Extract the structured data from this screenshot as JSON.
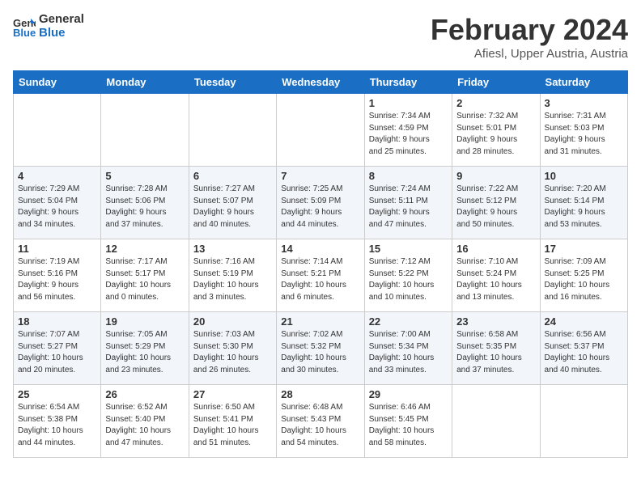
{
  "header": {
    "logo_line1": "General",
    "logo_line2": "Blue",
    "month_title": "February 2024",
    "location": "Afiesl, Upper Austria, Austria"
  },
  "days_of_week": [
    "Sunday",
    "Monday",
    "Tuesday",
    "Wednesday",
    "Thursday",
    "Friday",
    "Saturday"
  ],
  "weeks": [
    [
      {
        "day": "",
        "info": ""
      },
      {
        "day": "",
        "info": ""
      },
      {
        "day": "",
        "info": ""
      },
      {
        "day": "",
        "info": ""
      },
      {
        "day": "1",
        "info": "Sunrise: 7:34 AM\nSunset: 4:59 PM\nDaylight: 9 hours\nand 25 minutes."
      },
      {
        "day": "2",
        "info": "Sunrise: 7:32 AM\nSunset: 5:01 PM\nDaylight: 9 hours\nand 28 minutes."
      },
      {
        "day": "3",
        "info": "Sunrise: 7:31 AM\nSunset: 5:03 PM\nDaylight: 9 hours\nand 31 minutes."
      }
    ],
    [
      {
        "day": "4",
        "info": "Sunrise: 7:29 AM\nSunset: 5:04 PM\nDaylight: 9 hours\nand 34 minutes."
      },
      {
        "day": "5",
        "info": "Sunrise: 7:28 AM\nSunset: 5:06 PM\nDaylight: 9 hours\nand 37 minutes."
      },
      {
        "day": "6",
        "info": "Sunrise: 7:27 AM\nSunset: 5:07 PM\nDaylight: 9 hours\nand 40 minutes."
      },
      {
        "day": "7",
        "info": "Sunrise: 7:25 AM\nSunset: 5:09 PM\nDaylight: 9 hours\nand 44 minutes."
      },
      {
        "day": "8",
        "info": "Sunrise: 7:24 AM\nSunset: 5:11 PM\nDaylight: 9 hours\nand 47 minutes."
      },
      {
        "day": "9",
        "info": "Sunrise: 7:22 AM\nSunset: 5:12 PM\nDaylight: 9 hours\nand 50 minutes."
      },
      {
        "day": "10",
        "info": "Sunrise: 7:20 AM\nSunset: 5:14 PM\nDaylight: 9 hours\nand 53 minutes."
      }
    ],
    [
      {
        "day": "11",
        "info": "Sunrise: 7:19 AM\nSunset: 5:16 PM\nDaylight: 9 hours\nand 56 minutes."
      },
      {
        "day": "12",
        "info": "Sunrise: 7:17 AM\nSunset: 5:17 PM\nDaylight: 10 hours\nand 0 minutes."
      },
      {
        "day": "13",
        "info": "Sunrise: 7:16 AM\nSunset: 5:19 PM\nDaylight: 10 hours\nand 3 minutes."
      },
      {
        "day": "14",
        "info": "Sunrise: 7:14 AM\nSunset: 5:21 PM\nDaylight: 10 hours\nand 6 minutes."
      },
      {
        "day": "15",
        "info": "Sunrise: 7:12 AM\nSunset: 5:22 PM\nDaylight: 10 hours\nand 10 minutes."
      },
      {
        "day": "16",
        "info": "Sunrise: 7:10 AM\nSunset: 5:24 PM\nDaylight: 10 hours\nand 13 minutes."
      },
      {
        "day": "17",
        "info": "Sunrise: 7:09 AM\nSunset: 5:25 PM\nDaylight: 10 hours\nand 16 minutes."
      }
    ],
    [
      {
        "day": "18",
        "info": "Sunrise: 7:07 AM\nSunset: 5:27 PM\nDaylight: 10 hours\nand 20 minutes."
      },
      {
        "day": "19",
        "info": "Sunrise: 7:05 AM\nSunset: 5:29 PM\nDaylight: 10 hours\nand 23 minutes."
      },
      {
        "day": "20",
        "info": "Sunrise: 7:03 AM\nSunset: 5:30 PM\nDaylight: 10 hours\nand 26 minutes."
      },
      {
        "day": "21",
        "info": "Sunrise: 7:02 AM\nSunset: 5:32 PM\nDaylight: 10 hours\nand 30 minutes."
      },
      {
        "day": "22",
        "info": "Sunrise: 7:00 AM\nSunset: 5:34 PM\nDaylight: 10 hours\nand 33 minutes."
      },
      {
        "day": "23",
        "info": "Sunrise: 6:58 AM\nSunset: 5:35 PM\nDaylight: 10 hours\nand 37 minutes."
      },
      {
        "day": "24",
        "info": "Sunrise: 6:56 AM\nSunset: 5:37 PM\nDaylight: 10 hours\nand 40 minutes."
      }
    ],
    [
      {
        "day": "25",
        "info": "Sunrise: 6:54 AM\nSunset: 5:38 PM\nDaylight: 10 hours\nand 44 minutes."
      },
      {
        "day": "26",
        "info": "Sunrise: 6:52 AM\nSunset: 5:40 PM\nDaylight: 10 hours\nand 47 minutes."
      },
      {
        "day": "27",
        "info": "Sunrise: 6:50 AM\nSunset: 5:41 PM\nDaylight: 10 hours\nand 51 minutes."
      },
      {
        "day": "28",
        "info": "Sunrise: 6:48 AM\nSunset: 5:43 PM\nDaylight: 10 hours\nand 54 minutes."
      },
      {
        "day": "29",
        "info": "Sunrise: 6:46 AM\nSunset: 5:45 PM\nDaylight: 10 hours\nand 58 minutes."
      },
      {
        "day": "",
        "info": ""
      },
      {
        "day": "",
        "info": ""
      }
    ]
  ]
}
